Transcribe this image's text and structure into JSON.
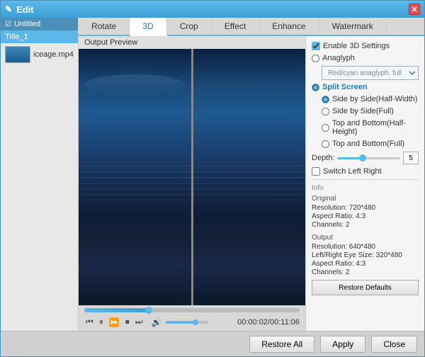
{
  "window": {
    "title": "Edit",
    "close_label": "✕"
  },
  "sidebar": {
    "header": "Untitled",
    "active_item": "Title_1",
    "file_item": "iceage.mp4"
  },
  "tabs": [
    {
      "id": "rotate",
      "label": "Rotate"
    },
    {
      "id": "3d",
      "label": "3D",
      "active": true
    },
    {
      "id": "crop",
      "label": "Crop"
    },
    {
      "id": "effect",
      "label": "Effect"
    },
    {
      "id": "enhance",
      "label": "Enhance"
    },
    {
      "id": "watermark",
      "label": "Watermark"
    }
  ],
  "preview": {
    "label": "Output Preview"
  },
  "playback": {
    "time_current": "00:00:02",
    "time_total": "00:11:06",
    "time_display": "00:00:02/00:11:06"
  },
  "settings": {
    "enable_3d_label": "Enable 3D Settings",
    "anaglyph_label": "Anaglyph",
    "anaglyph_dropdown": "Red/cyan anaglyph, full color",
    "split_screen_label": "Split Screen",
    "side_by_side_half_label": "Side by Side(Half-Width)",
    "side_by_side_full_label": "Side by Side(Full)",
    "top_bottom_half_label": "Top and Bottom(Half-Height)",
    "top_bottom_full_label": "Top and Bottom(Full)",
    "depth_label": "Depth:",
    "depth_value": "5",
    "switch_lr_label": "Switch Left Right",
    "info_title": "Info",
    "original_label": "Original",
    "original_resolution": "Resolution: 720*480",
    "original_aspect": "Aspect Ratio: 4:3",
    "original_channels": "Channels: 2",
    "output_label": "Output",
    "output_resolution": "Resolution: 640*480",
    "output_eye_size": "Left/Right Eye Size: 320*480",
    "output_aspect": "Aspect Ratio: 4:3",
    "output_channels": "Channels: 2",
    "restore_defaults_label": "Restore Defaults"
  },
  "bottom_bar": {
    "restore_all_label": "Restore All",
    "apply_label": "Apply",
    "close_label": "Close"
  },
  "controls": {
    "prev": "⏮",
    "play": "⏸",
    "fast_forward": "⏩",
    "stop": "⏹",
    "next": "⏭",
    "volume": "🔊"
  }
}
